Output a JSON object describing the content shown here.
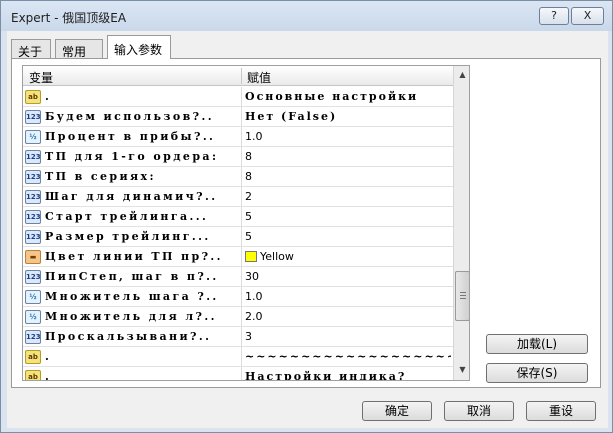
{
  "window": {
    "title": "Expert - 俄国顶级EA",
    "help_label": "?",
    "close_label": "X"
  },
  "tabs": [
    {
      "label": "关于"
    },
    {
      "label": "常用"
    },
    {
      "label": "输入参数"
    }
  ],
  "grid": {
    "col_variable": "变量",
    "col_value": "赋值",
    "rows": [
      {
        "icon": "ab",
        "name": ".",
        "value": "Основные настройки"
      },
      {
        "icon": "123",
        "name": "Будем использов?..",
        "value": "Нет (False)"
      },
      {
        "icon": "V2",
        "name": "Процент в прибы?..",
        "value": "1.0"
      },
      {
        "icon": "123",
        "name": "ТП для 1-го ордера:",
        "value": "8"
      },
      {
        "icon": "123",
        "name": "ТП в сериях:",
        "value": "8"
      },
      {
        "icon": "123",
        "name": "Шаг для динамич?..",
        "value": "2"
      },
      {
        "icon": "123",
        "name": "Старт трейлинга...",
        "value": "5"
      },
      {
        "icon": "123",
        "name": "Размер трейлинг...",
        "value": "5"
      },
      {
        "icon": "color",
        "name": "Цвет линии ТП пр?..",
        "value": "Yellow"
      },
      {
        "icon": "123",
        "name": "ПипСтеп, шаг в п?..",
        "value": "30"
      },
      {
        "icon": "V2",
        "name": "Множитель шага ?..",
        "value": "1.0"
      },
      {
        "icon": "V2",
        "name": "Множитель для л?..",
        "value": "2.0"
      },
      {
        "icon": "123",
        "name": "Проскальзывани?..",
        "value": "3"
      },
      {
        "icon": "ab",
        "name": ".",
        "value": "~~~~~~~~~~~~~~~~~~~~~..."
      },
      {
        "icon": "ab",
        "name": ".",
        "value": "Настройки индика?"
      }
    ]
  },
  "buttons": {
    "load": "加载(L)",
    "save": "保存(S)",
    "ok": "确定",
    "cancel": "取消",
    "reset": "重设"
  }
}
